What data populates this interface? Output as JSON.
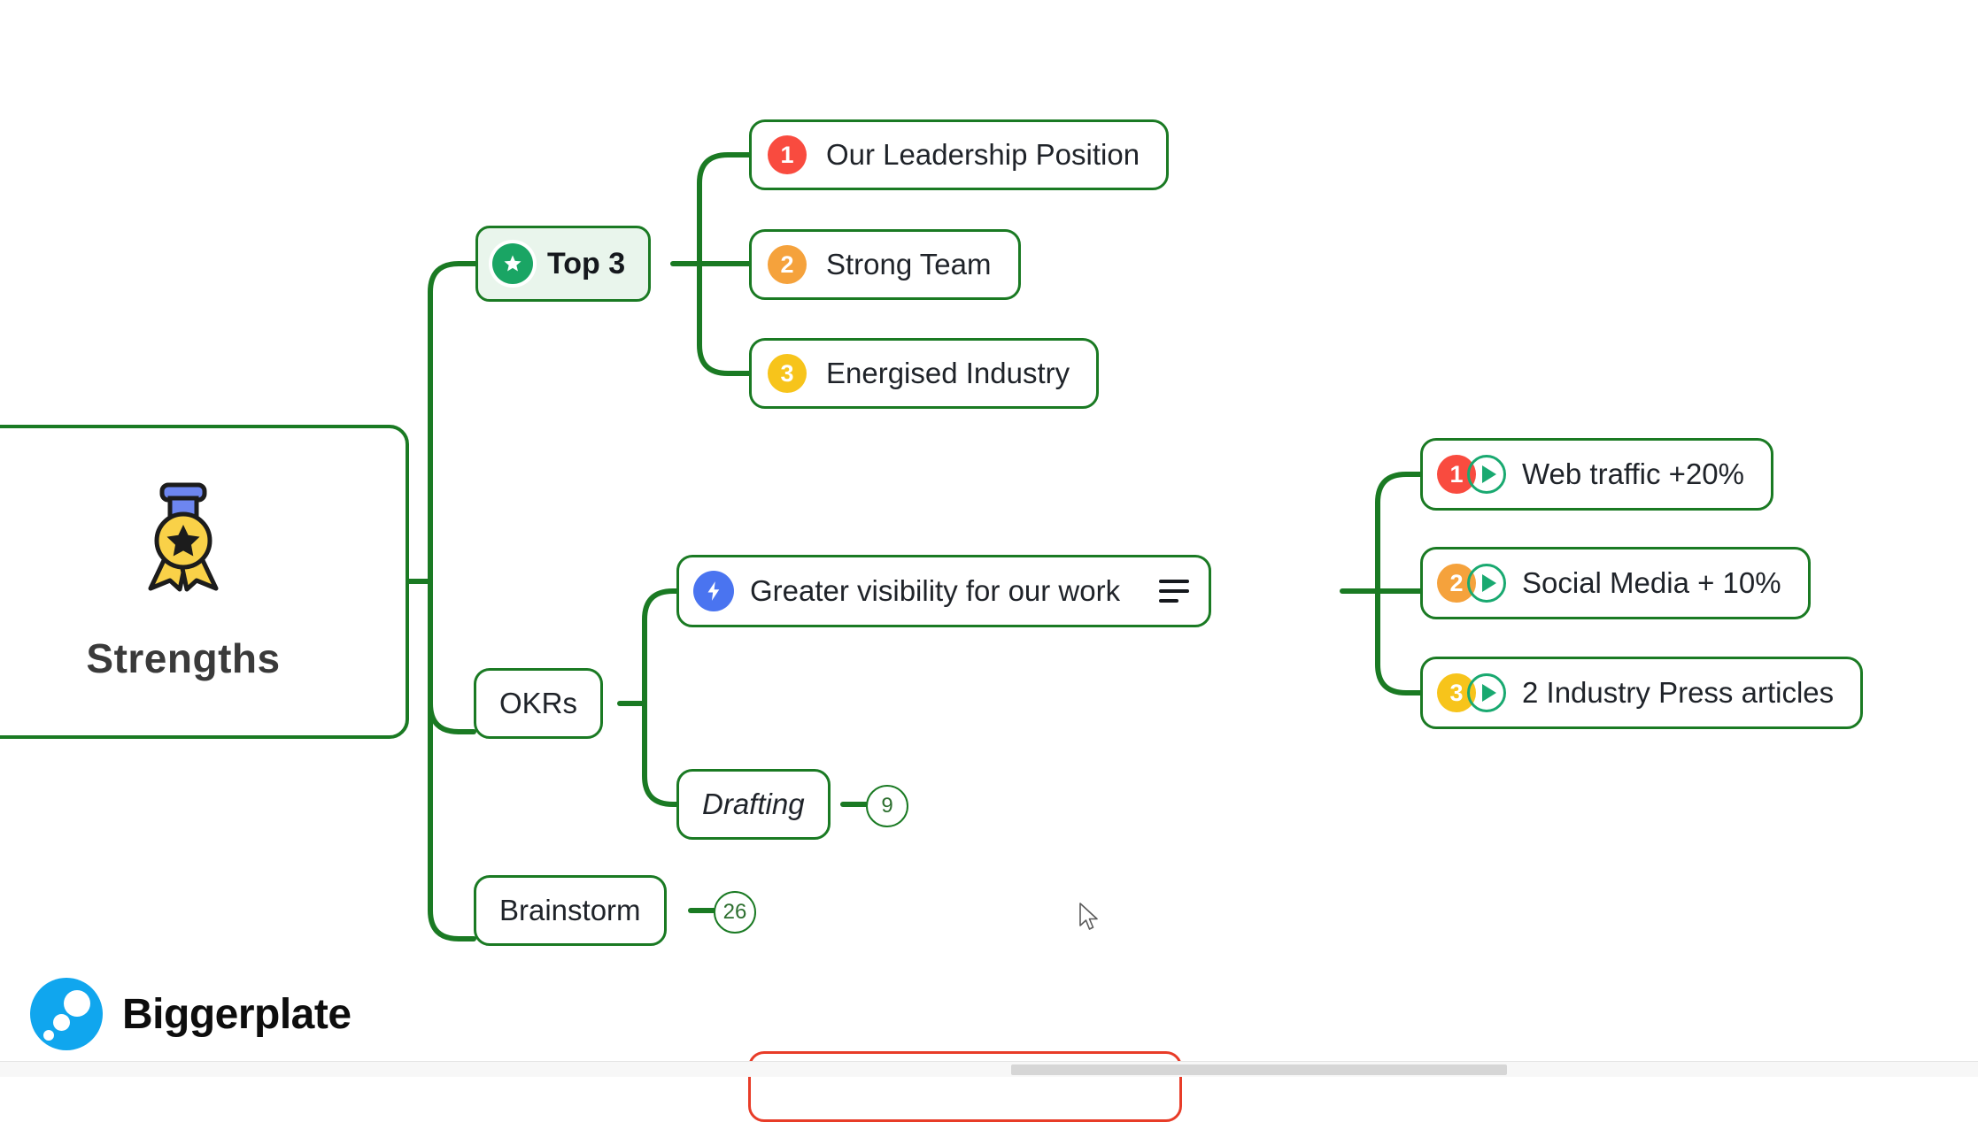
{
  "canvas": {
    "background": "#ffffff",
    "branch_color": "#1a7a23",
    "accent_green": "#19a970"
  },
  "root": {
    "label": "Strengths",
    "icon": "medal-award-icon"
  },
  "branches": {
    "top3": {
      "label": "Top 3",
      "icon": "star-circle-icon",
      "fill": "#e9f5ec",
      "children": [
        {
          "label": "Our Leadership Position",
          "badge": "1",
          "badge_color": "#f94b3f"
        },
        {
          "label": "Strong Team",
          "badge": "2",
          "badge_color": "#f5a23c"
        },
        {
          "label": "Energised Industry",
          "badge": "3",
          "badge_color": "#f7c41b"
        }
      ]
    },
    "okrs": {
      "label": "OKRs",
      "objective": {
        "label": "Greater visibility for our work",
        "icon": "lightning-bolt-icon",
        "icon_color": "#4a74f0",
        "notes_icon": "notes-lines-icon",
        "key_results": [
          {
            "label": "Web traffic +20%",
            "badge": "1",
            "badge_color": "#f94b3f",
            "status_icon": "play-circle-icon"
          },
          {
            "label": "Social Media + 10%",
            "badge": "2",
            "badge_color": "#f5a23c",
            "status_icon": "play-circle-icon"
          },
          {
            "label": "2 Industry Press articles",
            "badge": "3",
            "badge_color": "#f7c41b",
            "status_icon": "play-circle-icon"
          }
        ]
      },
      "drafting": {
        "label": "Drafting",
        "collapsed_count": "9"
      }
    },
    "brainstorm": {
      "label": "Brainstorm",
      "collapsed_count": "26"
    }
  },
  "watermark": {
    "label": "Biggerplate",
    "logo_icon": "biggerplate-bubbles-icon",
    "logo_color": "#10a6ee"
  },
  "partial_node": {
    "border_color": "#e83c28"
  }
}
